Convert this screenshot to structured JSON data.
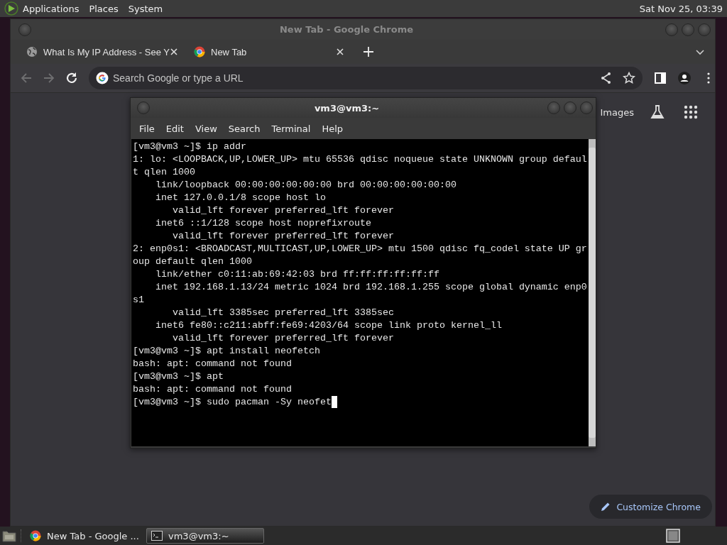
{
  "top_panel": {
    "menus": [
      "Applications",
      "Places",
      "System"
    ],
    "clock": "Sat Nov 25, 03:39"
  },
  "browser": {
    "title": "New Tab - Google Chrome",
    "tabs": [
      {
        "title": "What Is My IP Address - See Y",
        "kind": "globe"
      },
      {
        "title": "New Tab",
        "kind": "chrome"
      }
    ],
    "nav_buttons": [
      {
        "kind": "back",
        "disabled": true
      },
      {
        "kind": "forward",
        "disabled": true
      },
      {
        "kind": "reload",
        "disabled": false
      }
    ],
    "omnibox": {
      "placeholder": "Search Google or type a URL"
    },
    "page": {
      "links": [
        "Images"
      ],
      "customize_button": "Customize Chrome"
    }
  },
  "terminal": {
    "title": "vm3@vm3:~",
    "menus": [
      "File",
      "Edit",
      "View",
      "Search",
      "Terminal",
      "Help"
    ],
    "lines": [
      "[vm3@vm3 ~]$ ip addr",
      "1: lo: <LOOPBACK,UP,LOWER_UP> mtu 65536 qdisc noqueue state UNKNOWN group defaul",
      "t qlen 1000",
      "    link/loopback 00:00:00:00:00:00 brd 00:00:00:00:00:00",
      "    inet 127.0.0.1/8 scope host lo",
      "       valid_lft forever preferred_lft forever",
      "    inet6 ::1/128 scope host noprefixroute",
      "       valid_lft forever preferred_lft forever",
      "2: enp0s1: <BROADCAST,MULTICAST,UP,LOWER_UP> mtu 1500 qdisc fq_codel state UP gr",
      "oup default qlen 1000",
      "    link/ether c0:11:ab:69:42:03 brd ff:ff:ff:ff:ff:ff",
      "    inet 192.168.1.13/24 metric 1024 brd 192.168.1.255 scope global dynamic enp0",
      "s1",
      "       valid_lft 3385sec preferred_lft 3385sec",
      "    inet6 fe80::c211:abff:fe69:4203/64 scope link proto kernel_ll",
      "       valid_lft forever preferred_lft forever",
      "[vm3@vm3 ~]$ apt install neofetch",
      "bash: apt: command not found",
      "[vm3@vm3 ~]$ apt",
      "bash: apt: command not found",
      "[vm3@vm3 ~]$ sudo pacman -Sy neofet"
    ],
    "cursor": true
  },
  "taskbar": {
    "tasks": [
      {
        "label": "New Tab - Google ...",
        "kind": "chrome",
        "selected": false
      },
      {
        "label": "vm3@vm3:~",
        "kind": "terminal",
        "selected": true
      }
    ]
  }
}
